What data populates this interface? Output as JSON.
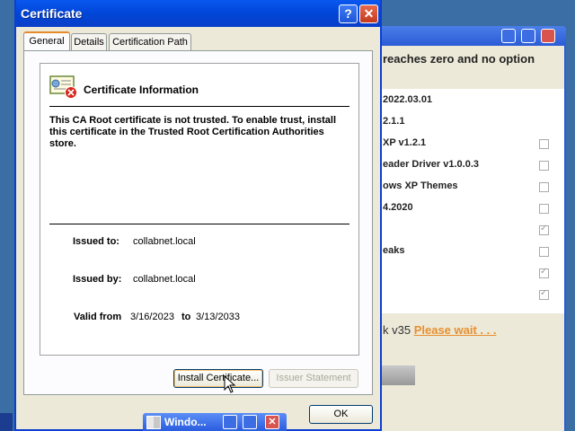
{
  "dialog": {
    "title": "Certificate",
    "tabs": [
      "General",
      "Details",
      "Certification Path"
    ],
    "info_title": "Certificate Information",
    "warning": "This CA Root certificate is not trusted. To enable trust, install this certificate in the Trusted Root Certification Authorities store.",
    "issued_to_label": "Issued to:",
    "issued_to": "collabnet.local",
    "issued_by_label": "Issued by:",
    "issued_by": "collabnet.local",
    "valid_from_label": "Valid from",
    "valid_from": "3/16/2023",
    "valid_to_label": "to",
    "valid_to": "3/13/2033",
    "install_button": "Install Certificate...",
    "issuer_button": "Issuer Statement",
    "ok_button": "OK"
  },
  "background_window": {
    "header": "reaches zero and no option",
    "rows": [
      {
        "label": "2022.03.01",
        "checked": false
      },
      {
        "label": "2.1.1",
        "checked": false
      },
      {
        "label": "XP v1.2.1",
        "checked": false
      },
      {
        "label": "eader Driver v1.0.0.3",
        "checked": false
      },
      {
        "label": "ows XP Themes",
        "checked": true
      },
      {
        "label": "4.2020",
        "checked": false
      },
      {
        "label": "",
        "checked": true
      },
      {
        "label": "eaks",
        "checked": true
      }
    ],
    "status_prefix": "k v35",
    "status_wait": "Please wait . . ."
  },
  "taskbar": {
    "window_button": "Windo..."
  }
}
